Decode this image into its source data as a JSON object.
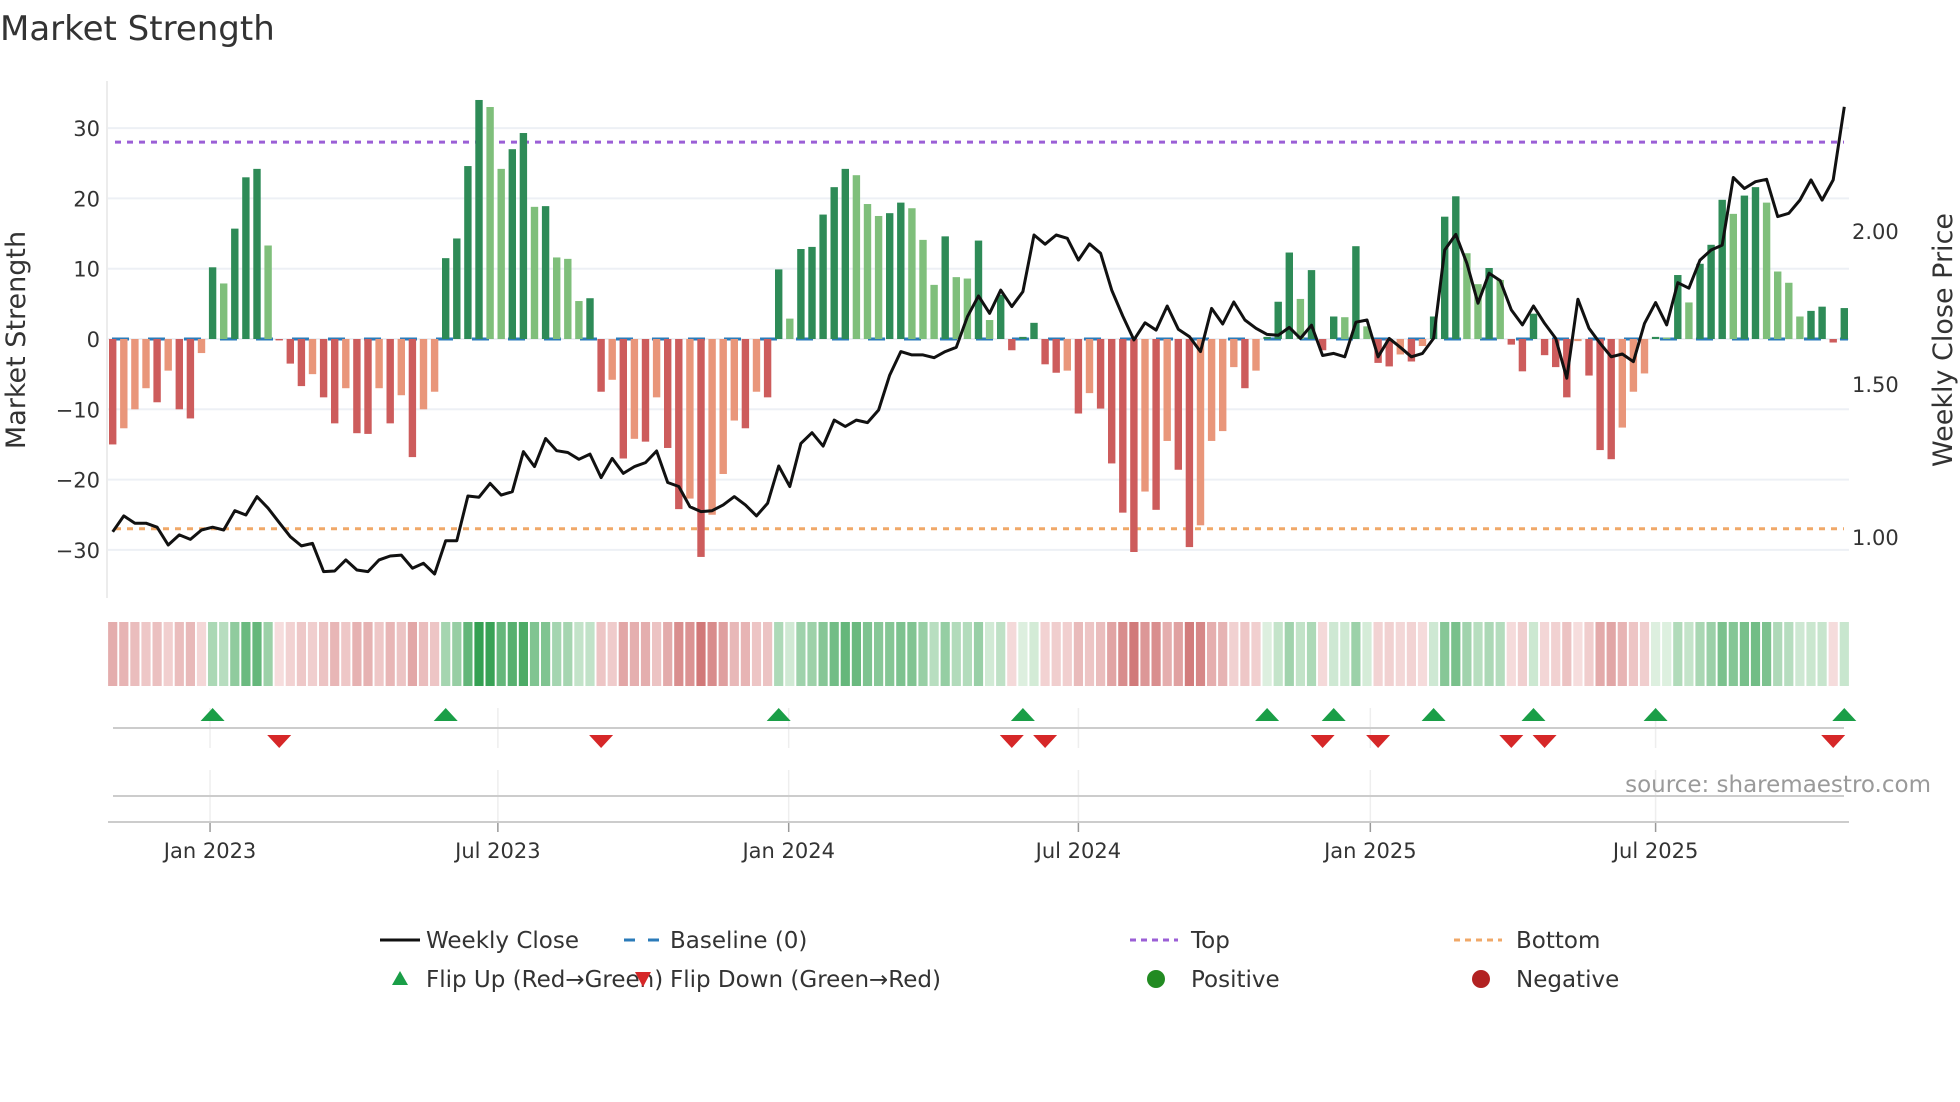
{
  "chart_data": {
    "type": "bar",
    "title": "Market Strength",
    "ylabel": "Market Strength",
    "y2label": "Weekly Close Price",
    "ylim": [
      -36.8,
      36.7
    ],
    "y2lim": [
      0.8,
      2.49
    ],
    "yticks": [
      30,
      20,
      10,
      0,
      -10,
      -20,
      -30
    ],
    "yticklabels": [
      "30",
      "20",
      "10",
      "0",
      "−10",
      "−20",
      "−30"
    ],
    "y2ticks": [
      1.0,
      1.5,
      2.0
    ],
    "y2ticklabels": [
      "1.00",
      "1.50",
      "2.00"
    ],
    "x_unit": "week index",
    "xticks": [
      {
        "week": 8.77,
        "label": "Jan 2023"
      },
      {
        "week": 34.7,
        "label": "Jul 2023"
      },
      {
        "week": 60.9,
        "label": "Jan 2024"
      },
      {
        "week": 87.0,
        "label": "Jul 2024"
      },
      {
        "week": 113.3,
        "label": "Jan 2025"
      },
      {
        "week": 139.0,
        "label": "Jul 2025"
      }
    ],
    "top_level": 28,
    "bottom_level": -27,
    "baseline": 0,
    "strength": [
      -15,
      -12.7,
      -10,
      -7,
      -9,
      -4.5,
      -10,
      -11.3,
      -2,
      10.2,
      7.9,
      15.7,
      23,
      24.2,
      13.3,
      -0.2,
      -3.5,
      -6.7,
      -5,
      -8.3,
      -12,
      -7,
      -13.4,
      -13.5,
      -7,
      -12,
      -8,
      -16.8,
      -10,
      -7.5,
      11.5,
      14.3,
      24.6,
      34,
      33,
      24.2,
      27,
      29.3,
      18.8,
      18.9,
      11.6,
      11.4,
      5.4,
      5.8,
      -7.5,
      -5.8,
      -17,
      -14.2,
      -14.6,
      -8.3,
      -15.5,
      -24.2,
      -22.7,
      -31,
      -25,
      -19.2,
      -11.6,
      -12.7,
      -7.5,
      -8.3,
      9.9,
      2.9,
      12.8,
      13.1,
      17.7,
      21.6,
      24.2,
      23.3,
      19.2,
      17.5,
      17.9,
      19.4,
      18.6,
      14.1,
      7.7,
      14.6,
      8.8,
      8.6,
      14,
      2.7,
      6.3,
      -1.6,
      0.3,
      2.3,
      -3.6,
      -4.8,
      -4.5,
      -10.6,
      -7.7,
      -9.9,
      -17.7,
      -24.7,
      -30.3,
      -21.7,
      -24.3,
      -14.5,
      -18.6,
      -29.6,
      -26.5,
      -14.5,
      -13.1,
      -4,
      -7,
      -4.5,
      0.3,
      5.3,
      12.3,
      5.7,
      9.8,
      -1.6,
      3.2,
      3.1,
      13.2,
      1.8,
      -3.4,
      -3.9,
      -2.2,
      -3.2,
      -1,
      3.2,
      17.4,
      20.3,
      12.2,
      7.8,
      10.1,
      8.4,
      -0.8,
      -4.6,
      3.6,
      -2.3,
      -4,
      -8.3,
      -0.3,
      -5.2,
      -15.8,
      -17.1,
      -12.6,
      -7.5,
      -4.9,
      0.3,
      0.2,
      9.1,
      5.2,
      10.7,
      13.4,
      19.8,
      17.8,
      20.4,
      21.6,
      19.4,
      9.6,
      8,
      3.2,
      4,
      4.6,
      -0.5,
      4.4
    ],
    "weekly_close": [
      1.017,
      1.069,
      1.045,
      1.045,
      1.032,
      0.974,
      1.007,
      0.992,
      1.023,
      1.032,
      1.023,
      1.086,
      1.072,
      1.132,
      1.094,
      1.047,
      1.001,
      0.971,
      0.979,
      0.887,
      0.889,
      0.925,
      0.892,
      0.887,
      0.925,
      0.938,
      0.941,
      0.898,
      0.914,
      0.879,
      0.988,
      0.988,
      1.134,
      1.13,
      1.175,
      1.137,
      1.148,
      1.279,
      1.23,
      1.322,
      1.282,
      1.276,
      1.254,
      1.271,
      1.194,
      1.257,
      1.208,
      1.23,
      1.243,
      1.281,
      1.178,
      1.165,
      1.099,
      1.083,
      1.086,
      1.105,
      1.132,
      1.105,
      1.069,
      1.11,
      1.232,
      1.165,
      1.306,
      1.341,
      1.297,
      1.382,
      1.361,
      1.382,
      1.374,
      1.415,
      1.529,
      1.606,
      1.595,
      1.595,
      1.586,
      1.606,
      1.62,
      1.72,
      1.788,
      1.731,
      1.807,
      1.753,
      1.802,
      1.987,
      1.957,
      1.987,
      1.976,
      1.905,
      1.958,
      1.927,
      1.807,
      1.722,
      1.644,
      1.7,
      1.676,
      1.755,
      1.679,
      1.655,
      1.606,
      1.747,
      1.696,
      1.768,
      1.709,
      1.682,
      1.662,
      1.659,
      1.685,
      1.649,
      1.692,
      1.593,
      1.6,
      1.589,
      1.702,
      1.709,
      1.589,
      1.649,
      1.62,
      1.589,
      1.6,
      1.649,
      1.938,
      1.989,
      1.894,
      1.764,
      1.862,
      1.838,
      1.742,
      1.693,
      1.755,
      1.698,
      1.649,
      1.519,
      1.777,
      1.682,
      1.633,
      1.589,
      1.598,
      1.573,
      1.698,
      1.766,
      1.693,
      1.831,
      1.813,
      1.905,
      1.938,
      1.954,
      2.175,
      2.139,
      2.161,
      2.169,
      2.047,
      2.058,
      2.101,
      2.167,
      2.101,
      2.167,
      2.406
    ],
    "flip_up_weeks": [
      9,
      30,
      60,
      82,
      104,
      110,
      119,
      128,
      139,
      156
    ],
    "flip_down_weeks": [
      15,
      44,
      81,
      84,
      109,
      114,
      126,
      129,
      155
    ],
    "legend": {
      "placement": "bottom",
      "items": [
        {
          "key": "close",
          "label": "Weekly Close"
        },
        {
          "key": "baseline",
          "label": "Baseline (0)"
        },
        {
          "key": "top",
          "label": "Top"
        },
        {
          "key": "bottom",
          "label": "Bottom"
        },
        {
          "key": "flipup",
          "label": "Flip Up (Red→Green)"
        },
        {
          "key": "flipdown",
          "label": "Flip Down (Green→Red)"
        },
        {
          "key": "positive",
          "label": "Positive"
        },
        {
          "key": "negative",
          "label": "Negative"
        }
      ]
    },
    "source": "source: sharemaestro.com",
    "colors": {
      "green_strong": "#2e8b57",
      "green_weak": "#7fbf7b",
      "red_strong": "#cd5c5c",
      "red_weak": "#e9967a",
      "close": "#111111",
      "baseline": "#2b7bb9",
      "top": "#9b5fd6",
      "bottom": "#f0a868",
      "flip_up": "#1a9e47",
      "flip_down": "#d62728",
      "positive": "#228b22",
      "negative": "#b22222"
    }
  }
}
